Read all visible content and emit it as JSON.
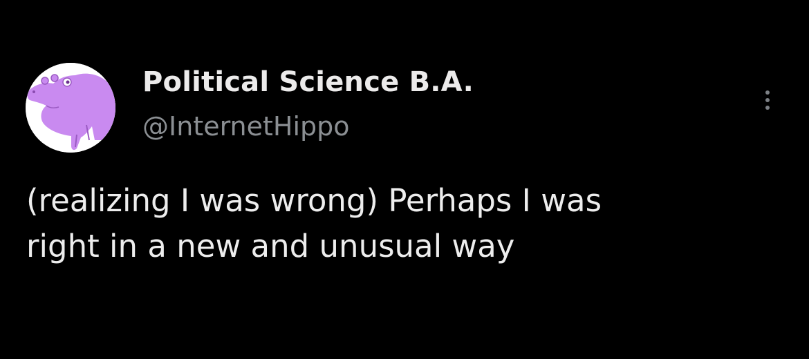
{
  "tweet": {
    "author": {
      "display_name": "Political Science B.A.",
      "handle": "@InternetHippo",
      "avatar_icon": "hippo-avatar-icon"
    },
    "text_line_1": "(realizing I was wrong) Perhaps I was",
    "text_line_2": "right in a new and unusual way",
    "more_icon": "more-options-icon"
  },
  "colors": {
    "background": "#000000",
    "display_name": "#ecebeb",
    "handle": "#8b8f93",
    "body_text": "#ededed",
    "avatar_hippo": "#c98af0"
  }
}
